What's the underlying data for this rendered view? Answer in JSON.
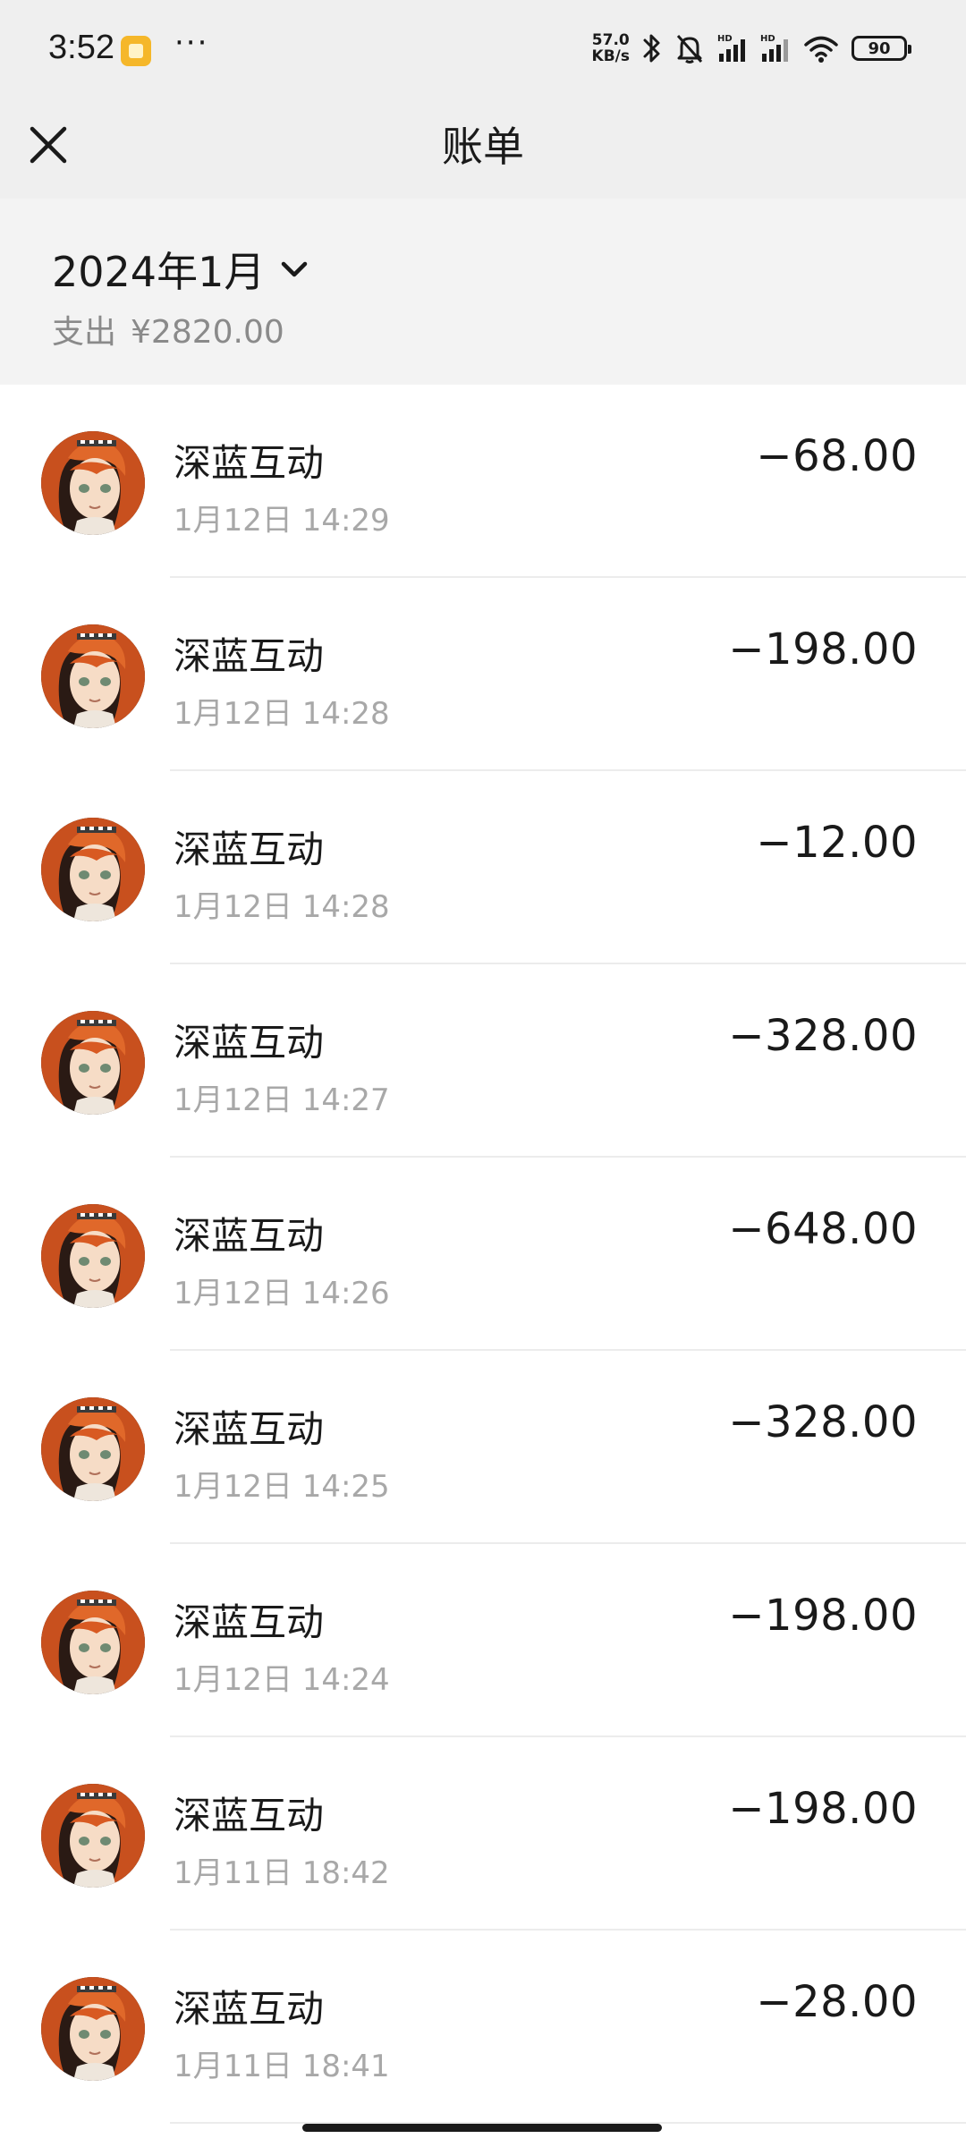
{
  "status_bar": {
    "time": "3:52",
    "more": "···",
    "net_speed_value": "57.0",
    "net_speed_unit": "KB/s",
    "battery": "90"
  },
  "header": {
    "title": "账单"
  },
  "summary": {
    "month": "2024年1月",
    "expense_label": "支出",
    "expense_value": "¥2820.00"
  },
  "transactions": [
    {
      "merchant": "深蓝互动",
      "time": "1月12日 14:29",
      "amount": "−68.00"
    },
    {
      "merchant": "深蓝互动",
      "time": "1月12日 14:28",
      "amount": "−198.00"
    },
    {
      "merchant": "深蓝互动",
      "time": "1月12日 14:28",
      "amount": "−12.00"
    },
    {
      "merchant": "深蓝互动",
      "time": "1月12日 14:27",
      "amount": "−328.00"
    },
    {
      "merchant": "深蓝互动",
      "time": "1月12日 14:26",
      "amount": "−648.00"
    },
    {
      "merchant": "深蓝互动",
      "time": "1月12日 14:25",
      "amount": "−328.00"
    },
    {
      "merchant": "深蓝互动",
      "time": "1月12日 14:24",
      "amount": "−198.00"
    },
    {
      "merchant": "深蓝互动",
      "time": "1月11日 18:42",
      "amount": "−198.00"
    },
    {
      "merchant": "深蓝互动",
      "time": "1月11日 18:41",
      "amount": "−28.00"
    }
  ],
  "icons": {
    "close": "close-icon",
    "month_dropdown": "chevron-down-icon",
    "avatar": "merchant-avatar"
  },
  "colors": {
    "header_bg": "#efefef",
    "summary_bg": "#f3f3f3",
    "secondary_text": "#a8a8a8",
    "avatar_hair": "#c8501e"
  }
}
